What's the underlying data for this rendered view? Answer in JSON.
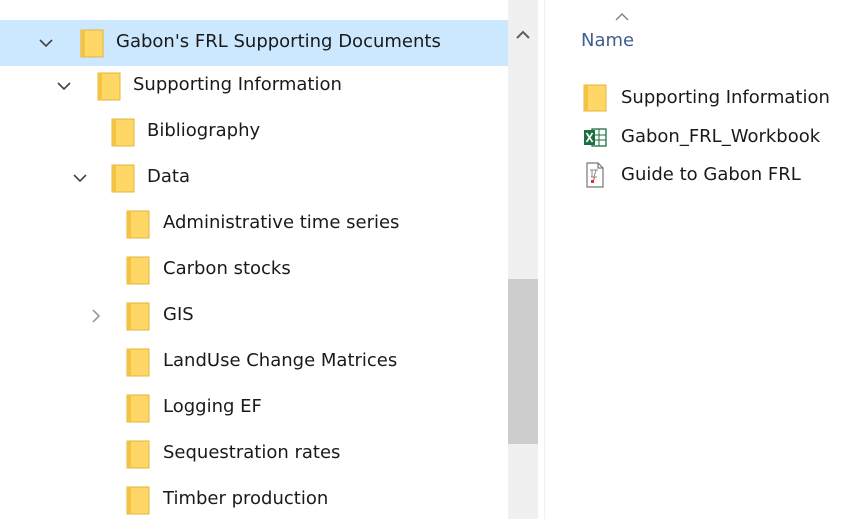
{
  "navigation_tree": {
    "items": [
      {
        "label": "Gabon's FRL Supporting Documents",
        "expanded": true,
        "selected": true
      },
      {
        "label": "Supporting Information",
        "expanded": true,
        "selected": false
      },
      {
        "label": "Bibliography",
        "selected": false
      },
      {
        "label": "Data",
        "expanded": true,
        "selected": false
      },
      {
        "label": "Administrative time series",
        "selected": false
      },
      {
        "label": "Carbon stocks",
        "selected": false
      },
      {
        "label": "GIS",
        "expanded": false,
        "selected": false
      },
      {
        "label": "LandUse Change Matrices",
        "selected": false
      },
      {
        "label": "Logging EF",
        "selected": false
      },
      {
        "label": "Sequestration rates",
        "selected": false
      },
      {
        "label": "Timber production",
        "selected": false
      }
    ]
  },
  "file_list": {
    "column_header": "Name",
    "sort_direction": "ascending",
    "items": [
      {
        "label": "Supporting Information",
        "icon": "folder-icon"
      },
      {
        "label": "Gabon_FRL_Workbook",
        "icon": "excel-file-icon"
      },
      {
        "label": "Guide to Gabon FRL",
        "icon": "pdf-file-icon"
      }
    ]
  },
  "colors": {
    "selection": "#cce8ff",
    "folder": "#ffd767",
    "excel": "#1d6f42",
    "scroll_thumb": "#cdcdcd"
  }
}
